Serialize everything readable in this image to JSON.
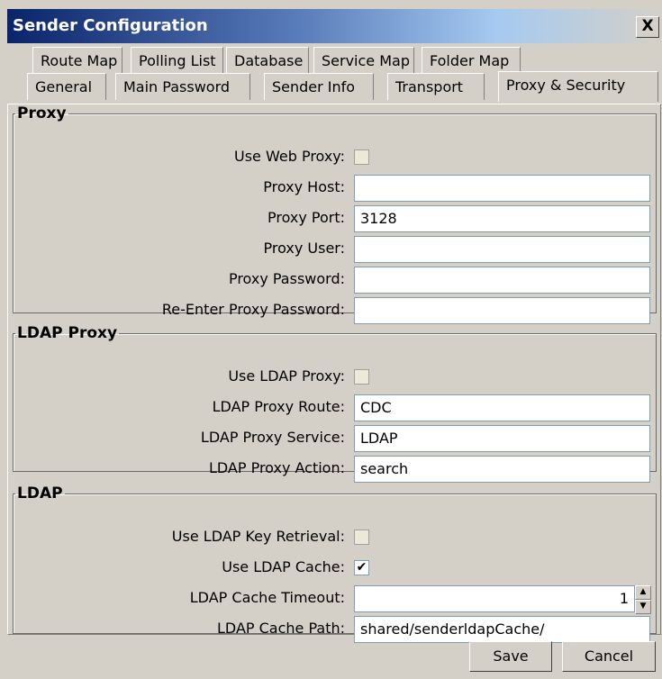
{
  "window": {
    "title": "Sender Configuration",
    "close_glyph": "X"
  },
  "tabs_row1": [
    "Route Map",
    "Polling List",
    "Database",
    "Service Map",
    "Folder Map"
  ],
  "tabs_row2": [
    "General",
    "Main Password",
    "Sender Info",
    "Transport",
    "Proxy & Security"
  ],
  "active_tab": "Proxy & Security",
  "proxy": {
    "legend": "Proxy",
    "use_web_proxy_label": "Use Web Proxy:",
    "use_web_proxy": false,
    "host_label": "Proxy Host:",
    "host": "",
    "port_label": "Proxy Port:",
    "port": "3128",
    "user_label": "Proxy User:",
    "user": "",
    "password_label": "Proxy Password:",
    "password": "",
    "reenter_label": "Re-Enter Proxy Password:",
    "reenter": ""
  },
  "ldap_proxy": {
    "legend": "LDAP Proxy",
    "use_label": "Use LDAP Proxy:",
    "use": false,
    "route_label": "LDAP Proxy Route:",
    "route": "CDC",
    "service_label": "LDAP Proxy Service:",
    "service": "LDAP",
    "action_label": "LDAP Proxy Action:",
    "action": "search"
  },
  "ldap": {
    "legend": "LDAP",
    "key_retrieval_label": "Use LDAP Key Retrieval:",
    "key_retrieval": false,
    "cache_label": "Use LDAP Cache:",
    "cache": true,
    "cache_check_glyph": "✔",
    "timeout_label": "LDAP Cache Timeout:",
    "timeout": "1",
    "spin_up_glyph": "▲",
    "spin_down_glyph": "▼",
    "path_label": "LDAP Cache Path:",
    "path": "shared/senderldapCache/"
  },
  "buttons": {
    "save": "Save",
    "cancel": "Cancel"
  }
}
